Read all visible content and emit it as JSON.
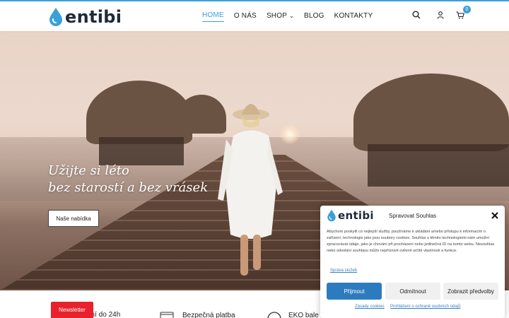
{
  "brand": {
    "name": "entibi",
    "accent": "#3aa0d8"
  },
  "nav": {
    "items": [
      {
        "label": "HOME",
        "active": true
      },
      {
        "label": "O NÁS",
        "active": false
      },
      {
        "label": "SHOP",
        "active": false,
        "dropdown": true
      },
      {
        "label": "BLOG",
        "active": false
      },
      {
        "label": "KONTAKTY",
        "active": false
      }
    ]
  },
  "header_icons": {
    "search": "search-icon",
    "account": "user-icon",
    "cart": "cart-icon",
    "cart_count": "0"
  },
  "hero": {
    "title_line1": "Užijte si léto",
    "title_line2": "bez starostí a bez vrásek",
    "button_label": "Naše nabídka"
  },
  "features": [
    {
      "icon": "truck-icon",
      "label": "čení do 24h"
    },
    {
      "icon": "card-icon",
      "label": "Bezpečná platba"
    },
    {
      "icon": "recycle-icon",
      "label": "EKO bale"
    }
  ],
  "newsletter": {
    "label": "Newsletter",
    "color": "#e8212b"
  },
  "consent": {
    "brand": "entibi",
    "title": "Spravovat Souhlas",
    "text": "Abychom poskytli co nejlepší služby, používáme k ukládání a/nebo přístupu k informacím o zařízení, technologie jako jsou soubory cookies. Souhlas s těmito technologiemi nám umožní zpracovávat údaje, jako je chování při procházení nebo jedinečná ID na tomto webu. Nesouhlas nebo odvolání souhlasu může nepříznivě ovlivnit určité vlastnosti a funkce.",
    "manage_link": "Správa služeb",
    "accept": "Přijmout",
    "deny": "Odmítnout",
    "preferences": "Zobrazit předvolby",
    "cookies_link": "Zásady cookies",
    "privacy_link": "Prohlášení o ochraně osobních údajů",
    "primary_color": "#2d7bbf"
  }
}
